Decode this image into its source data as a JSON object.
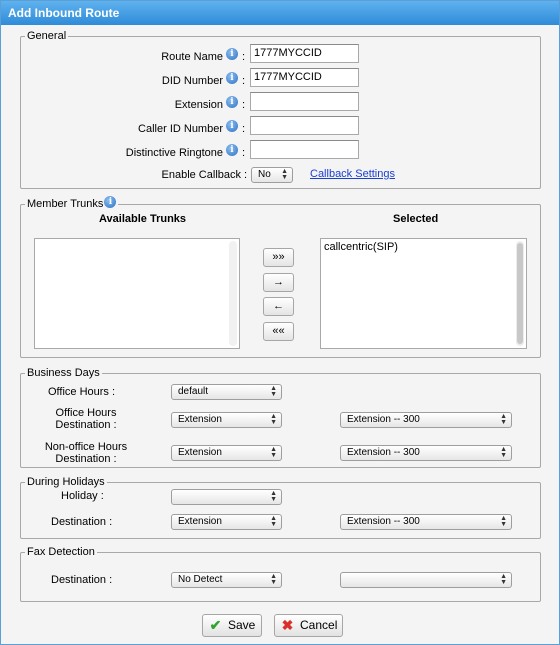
{
  "window": {
    "title": "Add Inbound Route"
  },
  "general": {
    "legend": "General",
    "route_name": {
      "label": "Route Name",
      "value": "1777MYCCID"
    },
    "did_number": {
      "label": "DID Number",
      "value": "1777MYCCID"
    },
    "extension": {
      "label": "Extension",
      "value": ""
    },
    "caller_id": {
      "label": "Caller ID Number",
      "value": ""
    },
    "ringtone": {
      "label": "Distinctive Ringtone",
      "value": ""
    },
    "callback": {
      "label": "Enable Callback",
      "value": "No",
      "settings_link": "Callback Settings"
    },
    "colon": ":"
  },
  "trunks": {
    "legend": "Member Trunks",
    "available_header": "Available Trunks",
    "selected_header": "Selected",
    "available": [],
    "selected": [
      "callcentric(SIP)"
    ],
    "buttons": {
      "add_all": "»»",
      "add": "→",
      "remove": "←",
      "remove_all": "««"
    }
  },
  "business": {
    "legend": "Business Days",
    "office_hours": {
      "label": "Office Hours :",
      "value": "default"
    },
    "office_dest": {
      "label_line1": "Office Hours",
      "label_line2": "Destination :",
      "type": "Extension",
      "target": "Extension -- 300"
    },
    "nonoffice_dest": {
      "label_line1": "Non-office Hours",
      "label_line2": "Destination :",
      "type": "Extension",
      "target": "Extension -- 300"
    }
  },
  "holidays": {
    "legend": "During Holidays",
    "holiday": {
      "label": "Holiday :",
      "value": ""
    },
    "destination": {
      "label": "Destination :",
      "type": "Extension",
      "target": "Extension -- 300"
    }
  },
  "fax": {
    "legend": "Fax Detection",
    "destination": {
      "label": "Destination :",
      "type": "No Detect",
      "target": ""
    }
  },
  "footer": {
    "save": "Save",
    "cancel": "Cancel"
  },
  "icons": {
    "info": "info-icon",
    "save": "check-icon",
    "cancel": "x-icon",
    "dropdown": "updown-arrow-icon"
  },
  "colors": {
    "title_bar": "#2f8bd9",
    "link": "#1a3fd1",
    "save_check": "#2fa52f",
    "cancel_x": "#d9302a"
  }
}
